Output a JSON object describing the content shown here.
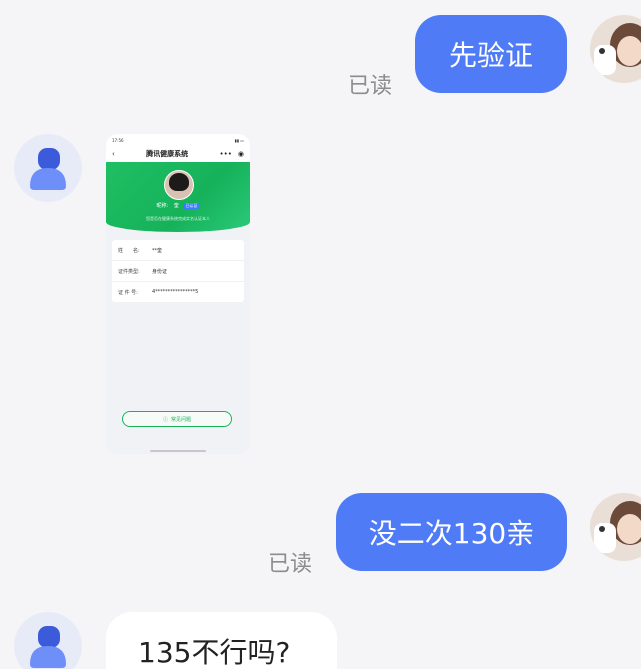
{
  "messages": {
    "m1": {
      "text": "先验证",
      "read": "已读"
    },
    "m3": {
      "text": "没二次130亲",
      "read": "已读"
    },
    "m4": {
      "text": "135不行吗?"
    }
  },
  "screenshot": {
    "status_time": "17:56",
    "title": "腾讯健康系统",
    "nickname_label": "昵称:",
    "nickname": "奎",
    "badge": "已认证",
    "tip": "您是否在健康系统完成实名认证本人",
    "rows": [
      {
        "key": "姓　　名:",
        "value": "**奎"
      },
      {
        "key": "证件类型:",
        "value": "身份证"
      },
      {
        "key": "证 件 号:",
        "value": "4****************5"
      }
    ],
    "faq": "常见问题"
  },
  "colors": {
    "my_bubble": "#4f7bf7",
    "other_bubble": "#ffffff",
    "background": "#f5f5f7",
    "green": "#19b25a"
  }
}
